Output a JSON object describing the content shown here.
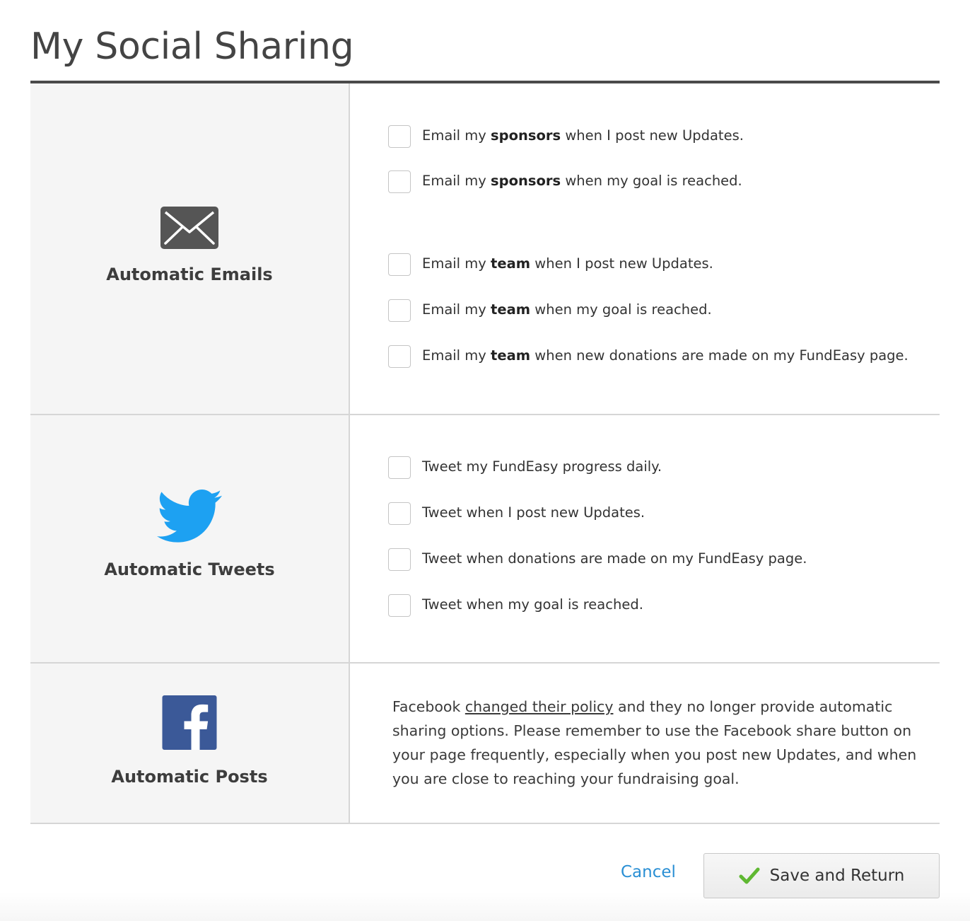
{
  "page": {
    "title": "My Social Sharing"
  },
  "emails": {
    "label": "Automatic Emails",
    "icon": "envelope-icon",
    "options": [
      {
        "prefix": "Email my ",
        "bold": "sponsors",
        "suffix": " when I post new Updates.",
        "checked": false
      },
      {
        "prefix": "Email my ",
        "bold": "sponsors",
        "suffix": " when my goal is reached.",
        "checked": false
      },
      {
        "prefix": "Email my ",
        "bold": "team",
        "suffix": " when I post new Updates.",
        "checked": false
      },
      {
        "prefix": "Email my ",
        "bold": "team",
        "suffix": " when my goal is reached.",
        "checked": false
      },
      {
        "prefix": "Email my ",
        "bold": "team",
        "suffix": " when new donations are made on my FundEasy page.",
        "checked": false
      }
    ]
  },
  "tweets": {
    "label": "Automatic Tweets",
    "icon": "twitter-bird-icon",
    "icon_color": "#1da1f2",
    "options": [
      {
        "text": "Tweet my FundEasy progress daily.",
        "checked": false
      },
      {
        "text": "Tweet when I post new Updates.",
        "checked": false
      },
      {
        "text": "Tweet when donations are made on my FundEasy page.",
        "checked": false
      },
      {
        "text": "Tweet when my goal is reached.",
        "checked": false
      }
    ]
  },
  "posts": {
    "label": "Automatic Posts",
    "icon": "facebook-icon",
    "icon_color": "#3b5998",
    "notice_before": "Facebook ",
    "notice_link": "changed their policy",
    "notice_after": " and they no longer provide automatic sharing options. Please remember to use the Facebook share button on your page frequently, especially when you post new Updates, and when you are close to reaching your fundraising goal."
  },
  "footer": {
    "cancel_label": "Cancel",
    "save_label": "Save and Return",
    "save_icon": "checkmark-icon",
    "save_icon_color": "#5fb832",
    "cancel_color": "#2a8fd4"
  }
}
